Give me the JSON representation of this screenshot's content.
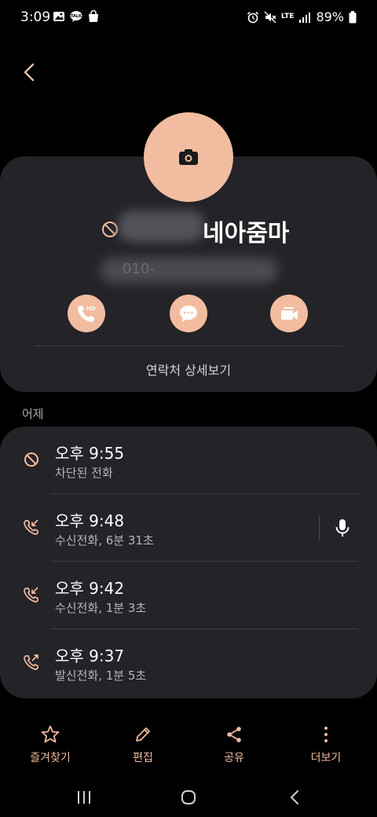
{
  "status_bar": {
    "time": "3:09",
    "lte": "LTE",
    "battery": "89%"
  },
  "contact": {
    "name": "네아줌마",
    "number": "010-",
    "details_link": "연락처 상세보기"
  },
  "section": {
    "label": "어제"
  },
  "call_log": [
    {
      "time": "오후 9:55",
      "sub": "차단된 전화",
      "type": "blocked-icon"
    },
    {
      "time": "오후 9:48",
      "sub": "수신전화, 6분 31초",
      "type": "incoming-call-icon",
      "recording": true
    },
    {
      "time": "오후 9:42",
      "sub": "수신전화, 1분 3초",
      "type": "incoming-call-icon"
    },
    {
      "time": "오후 9:37",
      "sub": "발신전화, 1분 5초",
      "type": "outgoing-call-icon"
    }
  ],
  "toolbar": {
    "favorite": "즐겨찾기",
    "edit": "편집",
    "share": "공유",
    "more": "더보기"
  },
  "colors": {
    "accent": "#f2bca0",
    "card": "#232328",
    "background": "#000000"
  }
}
